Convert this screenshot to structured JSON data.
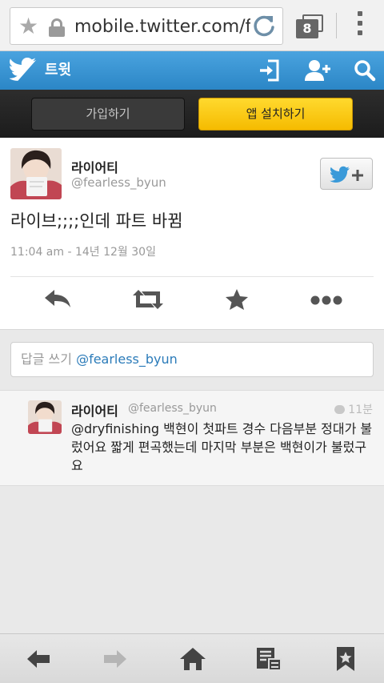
{
  "browser": {
    "url": "mobile.twitter.com/f",
    "tab_count": "8"
  },
  "header": {
    "title": "트윗"
  },
  "signup": {
    "join_label": "가입하기",
    "install_label": "앱 설치하기"
  },
  "tweet": {
    "author_name": "라이어티",
    "author_handle": "@fearless_byun",
    "text": "라이브;;;;인데 파트 바뀜",
    "timestamp": "11:04 am - 14년 12월 30일"
  },
  "reply_box": {
    "placeholder": "답글 쓰기",
    "mention": "@fearless_byun"
  },
  "reply": {
    "author_name": "라이어티",
    "author_handle": "@fearless_byun",
    "time": "11분",
    "text": "@dryfinishing 백현이 첫파트 경수 다음부분 정대가 불렀어요 짧게 편곡했는데 마지막 부분은 백현이가 불렀구요"
  },
  "colors": {
    "twitter_blue": "#2b86c6",
    "install_yellow": "#f5bb00",
    "link_blue": "#2b7bb9"
  },
  "icons": {
    "browser": [
      "star-icon",
      "lock-icon",
      "reload-icon",
      "tabs-icon",
      "menu-icon"
    ],
    "header": [
      "twitter-bird-icon",
      "sign-in-icon",
      "add-user-icon",
      "search-icon"
    ],
    "tweet_actions": [
      "reply-icon",
      "retweet-icon",
      "favorite-icon",
      "more-icon"
    ],
    "bottom_nav": [
      "back-icon",
      "forward-icon",
      "home-icon",
      "reader-icon",
      "bookmarks-icon"
    ]
  }
}
